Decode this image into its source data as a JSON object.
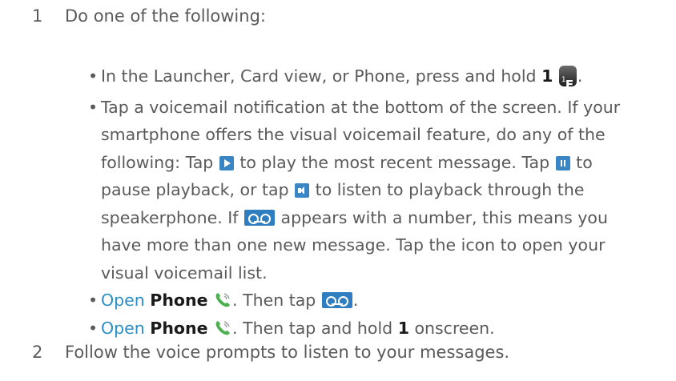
{
  "step1": {
    "number": "1",
    "text": "Do one of the following:"
  },
  "bullets": {
    "b1": {
      "pre": "In the Launcher, Card view, or Phone, press and hold ",
      "bold": "1",
      "post": "."
    },
    "b2": {
      "line1": "Tap a voicemail notification at the bottom of the screen. If your",
      "line2": "smartphone offers the visual voicemail feature, do any of the",
      "line3_pre": "following: Tap ",
      "line3_mid": " to play the most recent message. Tap ",
      "line3_post": " to",
      "line4_pre": "pause playback, or tap ",
      "line4_post": " to listen to playback through the",
      "line5_pre": "speakerphone. If ",
      "line5_post": " appears with a number, this means you",
      "line6": "have more than one new message. Tap the icon to open your",
      "line7": "visual voicemail list."
    },
    "b3": {
      "link": "Open",
      "bold": "Phone",
      "mid": ". Then tap ",
      "post": "."
    },
    "b4": {
      "link": "Open",
      "bold": "Phone",
      "mid": ". Then tap and hold ",
      "bold2": "1",
      "post": " onscreen."
    }
  },
  "step2": {
    "number": "2",
    "text": "Follow the voice prompts to listen to your messages."
  },
  "icons": {
    "key": "key-1-e-icon",
    "play": "play-icon",
    "pause": "pause-icon",
    "speaker": "speaker-icon",
    "voicemail": "voicemail-icon",
    "phone": "phone-icon"
  },
  "colors": {
    "text": "#5a5a5a",
    "link": "#2b8fc6",
    "icon_blue": "#3a86c4"
  }
}
